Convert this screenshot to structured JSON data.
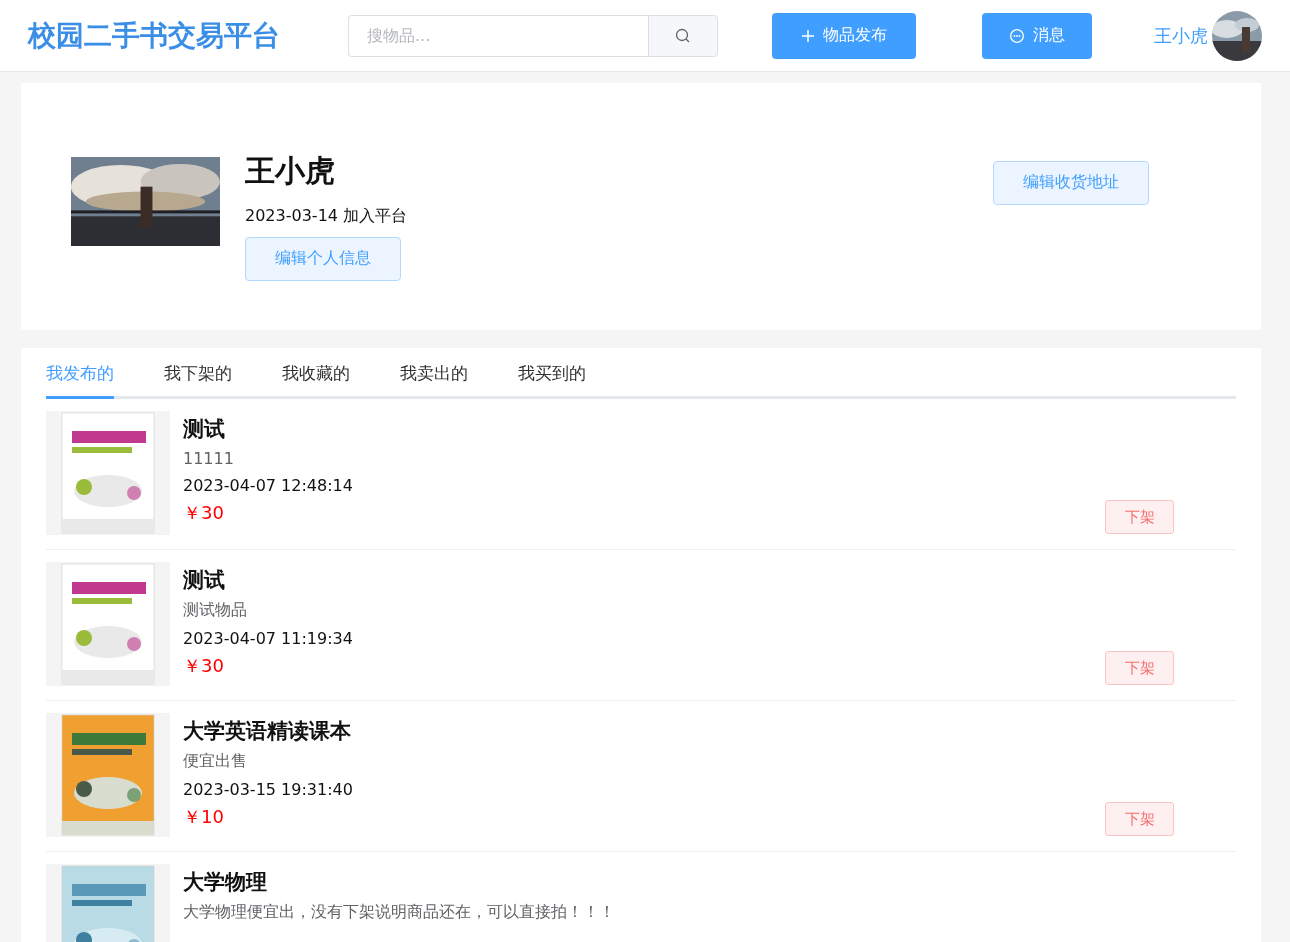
{
  "header": {
    "logo": "校园二手书交易平台",
    "search": {
      "placeholder": "搜物品..."
    },
    "publish_button": "物品发布",
    "message_button": "消息",
    "user_name": "王小虎"
  },
  "profile": {
    "name": "王小虎",
    "joined": "2023-03-14 加入平台",
    "edit_info_button": "编辑个人信息",
    "edit_address_button": "编辑收货地址"
  },
  "tabs": [
    {
      "label": "我发布的",
      "selected": true
    },
    {
      "label": "我下架的",
      "selected": false
    },
    {
      "label": "我收藏的",
      "selected": false
    },
    {
      "label": "我卖出的",
      "selected": false
    },
    {
      "label": "我买到的",
      "selected": false
    }
  ],
  "items": [
    {
      "title": "测试",
      "description": "11111",
      "time": "2023-04-07 12:48:14",
      "price": "￥30",
      "action": "下架"
    },
    {
      "title": "测试",
      "description": "测试物品",
      "time": "2023-04-07 11:19:34",
      "price": "￥30",
      "action": "下架"
    },
    {
      "title": "大学英语精读课本",
      "description": "便宜出售",
      "time": "2023-03-15 19:31:40",
      "price": "￥10",
      "action": "下架"
    },
    {
      "title": "大学物理",
      "description": "大学物理便宜出，没有下架说明商品还在，可以直接拍！！！"
    }
  ]
}
